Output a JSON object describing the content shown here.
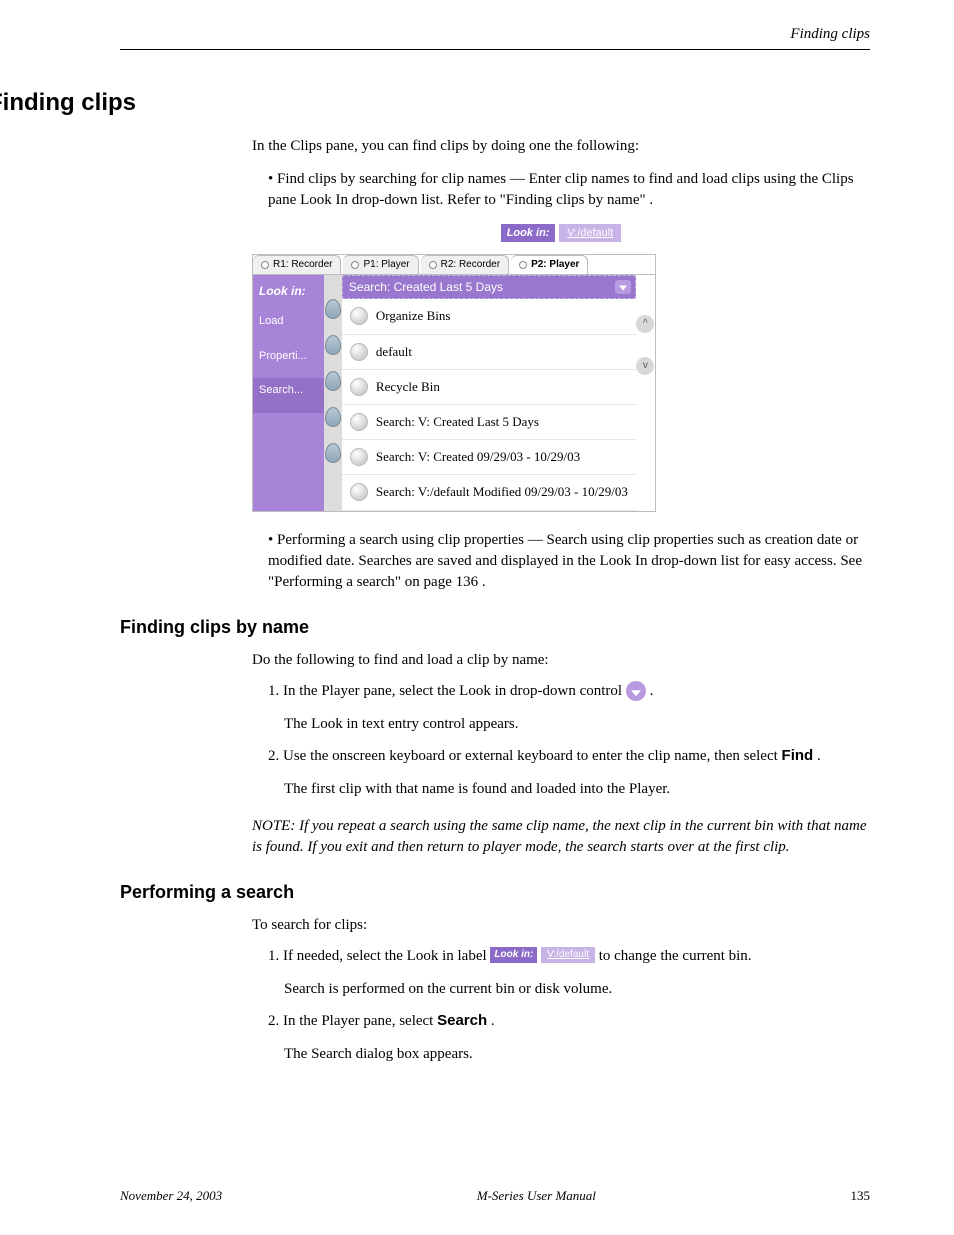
{
  "running_head": "Finding clips",
  "section_title": "Finding clips",
  "intro": "In the Clips pane, you can find clips by doing one the following:",
  "bullets": {
    "b1": "• Find clips by searching for clip names — Enter clip names to find and load clips using the Clips pane Look In drop-down list. Refer to ",
    "b1_link": "\"Finding clips by name\"",
    "b1_tail": ".",
    "b2": "• Performing a search using clip properties — Search using clip properties such as creation date or modified date. Searches are saved and displayed in the Look In drop-down list for easy access. See ",
    "b2_link": "\"Performing a search\" on page 136",
    "b2_tail": "."
  },
  "figure": {
    "lookin_label": "Look in:",
    "lookin_value": "V:/default",
    "tabs": [
      "R1: Recorder",
      "P1: Player",
      "R2: Recorder",
      "P2: Player"
    ],
    "sidebar": {
      "look": "Look in:",
      "load": "Load",
      "properties": "Properti...",
      "search": "Search..."
    },
    "search_header": "Search: Created Last 5 Days",
    "items": [
      "Organize Bins",
      "default",
      "Recycle Bin",
      "Search: V: Created Last 5 Days",
      "Search: V: Created 09/29/03 - 10/29/03",
      "Search: V:/default Modified 09/29/03 - 10/29/03"
    ]
  },
  "sub_title": "Finding clips by name",
  "sub_intro": "Do the following to find and load a clip by name:",
  "steps": {
    "s1_num": "1.",
    "s1": "In the Player pane, select the Look in drop-down control ",
    "s1_tail": ".",
    "s1_after": "The Look in text entry control appears.",
    "s2_num": "2.",
    "s2": "Use the onscreen keyboard or external keyboard to enter the clip name, then select ",
    "s2_find": "Find",
    "s2_tail": ".",
    "s2_after": "The first clip with that name is found and loaded into the Player.",
    "note": "If you repeat a search using the same clip name, the next clip in the current bin with that name is found. If you exit and then return to player mode, the search starts over at the first clip."
  },
  "sub2_title": "Performing a search",
  "sub2_intro": "To search for clips:",
  "s2steps": {
    "s1_num": "1.",
    "s1": "If needed, select the Look in label ",
    "s1_tail": " to change the current bin.",
    "s1_after": "Search is performed on the current bin or disk volume.",
    "s2_num": "2.",
    "s2": "In the Player pane, select ",
    "s2_search": "Search",
    "s2_tail": ".",
    "s2_after": "The Search dialog box appears."
  },
  "note_label": "NOTE: ",
  "footer": {
    "date": "November 24, 2003",
    "manual": "M-Series User Manual",
    "page": "135"
  }
}
